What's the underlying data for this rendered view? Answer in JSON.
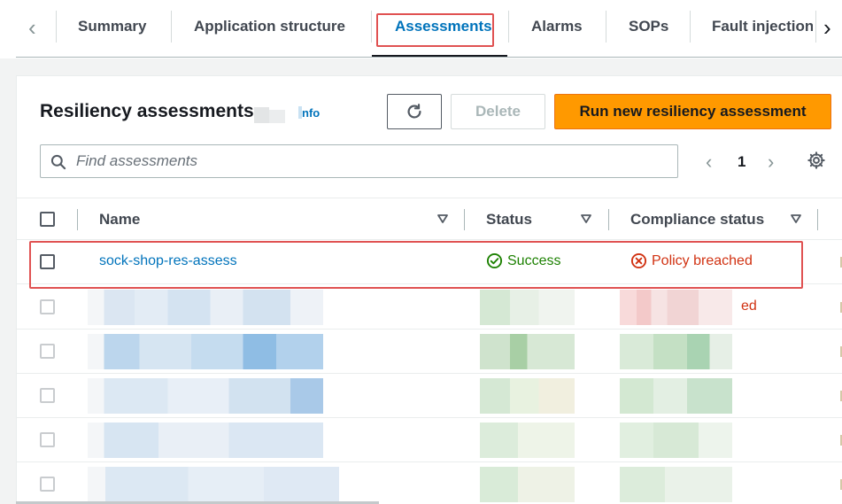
{
  "tabs": {
    "items": [
      {
        "label": "Summary"
      },
      {
        "label": "Application structure"
      },
      {
        "label": "Assessments"
      },
      {
        "label": "Alarms"
      },
      {
        "label": "SOPs"
      },
      {
        "label": "Fault injection"
      }
    ],
    "active": "Assessments"
  },
  "panel": {
    "title": "Resiliency assessments",
    "info_label": "nfo",
    "delete_label": "Delete",
    "run_label": "Run new resiliency assessment"
  },
  "search": {
    "placeholder": "Find assessments"
  },
  "pagination": {
    "current_page": "1"
  },
  "table": {
    "columns": [
      "Name",
      "Status",
      "Compliance status"
    ],
    "rows": [
      {
        "name": "sock-shop-res-assess",
        "status": "Success",
        "compliance": "Policy breached"
      }
    ],
    "partial_text": "ed"
  },
  "colors": {
    "accent": "#0073bb",
    "primary_button": "#ff9900",
    "success": "#1d8102",
    "error": "#d13212",
    "highlight": "#e05252"
  }
}
